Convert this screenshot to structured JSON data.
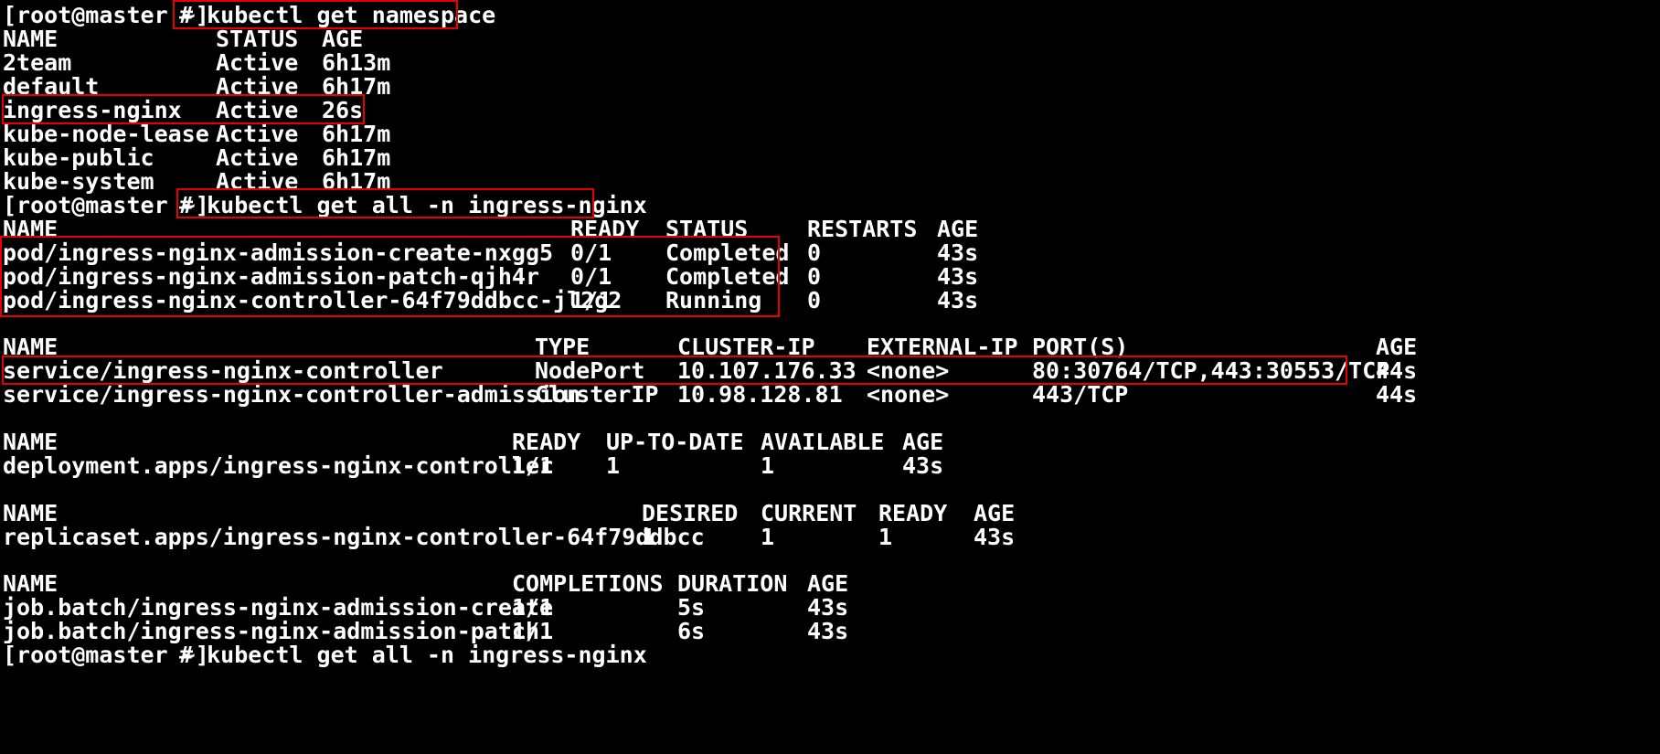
{
  "terminal": {
    "prompt": "[root@master ~]",
    "commands": [
      "# kubectl get namespace",
      "# kubectl get all -n ingress-nginx",
      "# kubectl get all -n ingress-nginx"
    ]
  },
  "namespaces": {
    "headers": [
      "NAME",
      "STATUS",
      "AGE"
    ],
    "rows": [
      [
        "2team",
        "Active",
        "6h13m"
      ],
      [
        "default",
        "Active",
        "6h17m"
      ],
      [
        "ingress-nginx",
        "Active",
        "26s"
      ],
      [
        "kube-node-lease",
        "Active",
        "6h17m"
      ],
      [
        "kube-public",
        "Active",
        "6h17m"
      ],
      [
        "kube-system",
        "Active",
        "6h17m"
      ]
    ]
  },
  "pods": {
    "headers": [
      "NAME",
      "READY",
      "STATUS",
      "RESTARTS",
      "AGE"
    ],
    "rows": [
      [
        "pod/ingress-nginx-admission-create-nxgg5",
        "0/1",
        "Completed",
        "0",
        "43s"
      ],
      [
        "pod/ingress-nginx-admission-patch-qjh4r",
        "0/1",
        "Completed",
        "0",
        "43s"
      ],
      [
        "pod/ingress-nginx-controller-64f79ddbcc-jl2g2",
        "1/1",
        "Running",
        "0",
        "43s"
      ]
    ]
  },
  "services": {
    "headers": [
      "NAME",
      "TYPE",
      "CLUSTER-IP",
      "EXTERNAL-IP",
      "PORT(S)",
      "AGE"
    ],
    "rows": [
      [
        "service/ingress-nginx-controller",
        "NodePort",
        "10.107.176.33",
        "<none>",
        "80:30764/TCP,443:30553/TCP",
        "44s"
      ],
      [
        "service/ingress-nginx-controller-admission",
        "ClusterIP",
        "10.98.128.81",
        "<none>",
        "443/TCP",
        "44s"
      ]
    ]
  },
  "deployments": {
    "headers": [
      "NAME",
      "READY",
      "UP-TO-DATE",
      "AVAILABLE",
      "AGE"
    ],
    "rows": [
      [
        "deployment.apps/ingress-nginx-controller",
        "1/1",
        "1",
        "1",
        "43s"
      ]
    ]
  },
  "replicasets": {
    "headers": [
      "NAME",
      "DESIRED",
      "CURRENT",
      "READY",
      "AGE"
    ],
    "rows": [
      [
        "replicaset.apps/ingress-nginx-controller-64f79ddbcc",
        "1",
        "1",
        "1",
        "43s"
      ]
    ]
  },
  "jobs": {
    "headers": [
      "NAME",
      "COMPLETIONS",
      "DURATION",
      "AGE"
    ],
    "rows": [
      [
        "job.batch/ingress-nginx-admission-create",
        "1/1",
        "5s",
        "43s"
      ],
      [
        "job.batch/ingress-nginx-admission-patch",
        "1/1",
        "6s",
        "43s"
      ]
    ]
  },
  "colors": {
    "background": "#000000",
    "text": "#ffffff",
    "highlight_box": "#e60000"
  }
}
